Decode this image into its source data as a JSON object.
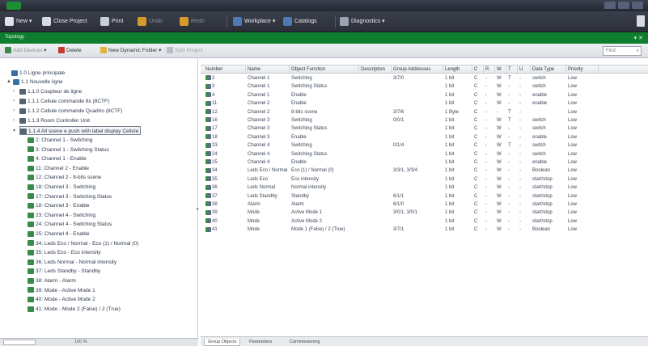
{
  "toolbar": {
    "new_label": "New",
    "close_project_label": "Close Project",
    "print_label": "Print",
    "undo_label": "Undo",
    "redo_label": "Redo",
    "workplace_label": "Workplace",
    "catalogs_label": "Catalogs",
    "diagnostics_label": "Diagnostics"
  },
  "panel": {
    "title": "Topology",
    "controls": "▾ ✕"
  },
  "subtoolbar": {
    "add_devices_label": "Add Devices",
    "delete_label": "Delete",
    "new_dynamic_folder_label": "New Dynamic Folder",
    "help_label": "Split Project",
    "search_placeholder": "Find"
  },
  "tree": {
    "items": [
      {
        "label": "1.0 Ligne principale",
        "icon_color": "#3b6ea5"
      },
      {
        "label": "1.1 Nouvelle ligne",
        "icon_color": "#3b6ea5"
      },
      {
        "label": "1.1.0 Coupleur de ligne",
        "icon_color": "#556270"
      },
      {
        "label": "1.1.1 Cellule commande 8x (8CTF)",
        "icon_color": "#556270"
      },
      {
        "label": "1.1.2 Cellule commande Quadrio (8CTF)",
        "icon_color": "#556270"
      },
      {
        "label": "1.1.3 Room Controller Unit",
        "icon_color": "#556270"
      },
      {
        "label": "1.1.4 All scene e push with label display Cellule",
        "icon_color": "#556270"
      },
      {
        "label": "2: Channel 1 - Switching",
        "icon_color": "#3a8a4b"
      },
      {
        "label": "3: Channel 1 - Switching Status",
        "icon_color": "#3a8a4b"
      },
      {
        "label": "4: Channel 1 - Enable",
        "icon_color": "#3a8a4b"
      },
      {
        "label": "11: Channel 2 - Enable",
        "icon_color": "#3a8a4b"
      },
      {
        "label": "12: Channel 2 - 8-bits scene",
        "icon_color": "#3a8a4b"
      },
      {
        "label": "18: Channel 3 - Switching",
        "icon_color": "#3a8a4b"
      },
      {
        "label": "17: Channel 3 - Switching Status",
        "icon_color": "#3a8a4b"
      },
      {
        "label": "18: Channel 3 - Enable",
        "icon_color": "#3a8a4b"
      },
      {
        "label": "23: Channel 4 - Switching",
        "icon_color": "#3a8a4b"
      },
      {
        "label": "24: Channel 4 - Switching Status",
        "icon_color": "#3a8a4b"
      },
      {
        "label": "25: Channel 4 - Enable",
        "icon_color": "#3a8a4b"
      },
      {
        "label": "34: Leds Eco / Normal - Eco (1) / Normal (0)",
        "icon_color": "#3a8a4b"
      },
      {
        "label": "35: Leds Eco - Eco intensity",
        "icon_color": "#3a8a4b"
      },
      {
        "label": "36: Leds Normal - Normal intensity",
        "icon_color": "#3a8a4b"
      },
      {
        "label": "37: Leds Standby - Standby",
        "icon_color": "#3a8a4b"
      },
      {
        "label": "38: Alarm - Alarm",
        "icon_color": "#3a8a4b"
      },
      {
        "label": "39: Mode - Active Mode 1",
        "icon_color": "#3a8a4b"
      },
      {
        "label": "40: Mode - Active Mode 2",
        "icon_color": "#3a8a4b"
      },
      {
        "label": "41: Mode - Mode 2 (False) / 2 (True)",
        "icon_color": "#3a8a4b"
      }
    ]
  },
  "left_status": {
    "zoom": "100 %"
  },
  "table": {
    "columns": [
      "Number",
      "Name",
      "Object Function",
      "Description",
      "Group Addresses",
      "Length",
      "C",
      "R",
      "W",
      "T",
      "U",
      "Data Type",
      "Priority"
    ],
    "rows": [
      [
        "2",
        "Channel 1",
        "Switching",
        "",
        "3/7/0",
        "1 bit",
        "C",
        "-",
        "W",
        "T",
        "-",
        "switch",
        "Low"
      ],
      [
        "3",
        "Channel 1",
        "Switching Status",
        "",
        "",
        "1 bit",
        "C",
        "-",
        "W",
        "-",
        "-",
        "switch",
        "Low"
      ],
      [
        "4",
        "Channel 1",
        "Enable",
        "",
        "",
        "1 bit",
        "C",
        "-",
        "W",
        "-",
        "-",
        "enable",
        "Low"
      ],
      [
        "11",
        "Channel 2",
        "Enable",
        "",
        "",
        "1 bit",
        "C",
        "-",
        "W",
        "-",
        "-",
        "enable",
        "Low"
      ],
      [
        "12",
        "Channel 2",
        "8-bits scene",
        "",
        "3/7/6",
        "1 Byte",
        "C",
        "-",
        "-",
        "T",
        "-",
        "",
        "Low"
      ],
      [
        "16",
        "Channel 3",
        "Switching",
        "",
        "0/0/1",
        "1 bit",
        "C",
        "-",
        "W",
        "T",
        "-",
        "switch",
        "Low"
      ],
      [
        "17",
        "Channel 3",
        "Switching Status",
        "",
        "",
        "1 bit",
        "C",
        "-",
        "W",
        "-",
        "-",
        "switch",
        "Low"
      ],
      [
        "18",
        "Channel 3",
        "Enable",
        "",
        "",
        "1 bit",
        "C",
        "-",
        "W",
        "-",
        "-",
        "enable",
        "Low"
      ],
      [
        "23",
        "Channel 4",
        "Switching",
        "",
        "0/1/4",
        "1 bit",
        "C",
        "-",
        "W",
        "T",
        "-",
        "switch",
        "Low"
      ],
      [
        "24",
        "Channel 4",
        "Switching Status",
        "",
        "",
        "1 bit",
        "C",
        "-",
        "W",
        "-",
        "-",
        "switch",
        "Low"
      ],
      [
        "25",
        "Channel 4",
        "Enable",
        "",
        "",
        "1 bit",
        "C",
        "-",
        "W",
        "-",
        "-",
        "enable",
        "Low"
      ],
      [
        "34",
        "Leds Eco / Normal",
        "Eco (1) / Normal (0)",
        "",
        "3/3/1, 3/3/4",
        "1 bit",
        "C",
        "-",
        "W",
        "-",
        "-",
        "Boolean",
        "Low"
      ],
      [
        "35",
        "Leds Eco",
        "Eco intensity",
        "",
        "",
        "1 bit",
        "C",
        "-",
        "W",
        "-",
        "-",
        "start/stop",
        "Low"
      ],
      [
        "36",
        "Leds Normal",
        "Normal intensity",
        "",
        "",
        "1 bit",
        "C",
        "-",
        "W",
        "-",
        "-",
        "start/stop",
        "Low"
      ],
      [
        "37",
        "Leds Standby",
        "Standby",
        "",
        "6/1/1",
        "1 bit",
        "C",
        "-",
        "W",
        "-",
        "-",
        "start/stop",
        "Low"
      ],
      [
        "38",
        "Alarm",
        "Alarm",
        "",
        "6/1/0",
        "1 bit",
        "C",
        "-",
        "W",
        "-",
        "-",
        "start/stop",
        "Low"
      ],
      [
        "39",
        "Mode",
        "Active Mode 1",
        "",
        "3/0/1, 3/0/1",
        "1 bit",
        "C",
        "-",
        "W",
        "-",
        "-",
        "start/stop",
        "Low"
      ],
      [
        "40",
        "Mode",
        "Active Mode 2",
        "",
        "",
        "1 bit",
        "C",
        "-",
        "W",
        "-",
        "-",
        "start/stop",
        "Low"
      ],
      [
        "41",
        "Mode",
        "Mode 1 (False) / 2 (True)",
        "",
        "3/7/1",
        "1 bit",
        "C",
        "-",
        "W",
        "-",
        "-",
        "Boolean",
        "Low"
      ]
    ]
  },
  "bottom_tabs": {
    "group_objects": "Group Objects",
    "parameters": "Parameters",
    "commissioning": "Commissioning"
  },
  "colors": {
    "accent_green": "#0f7d2e",
    "toolbar_dark": "#2b2f38"
  }
}
